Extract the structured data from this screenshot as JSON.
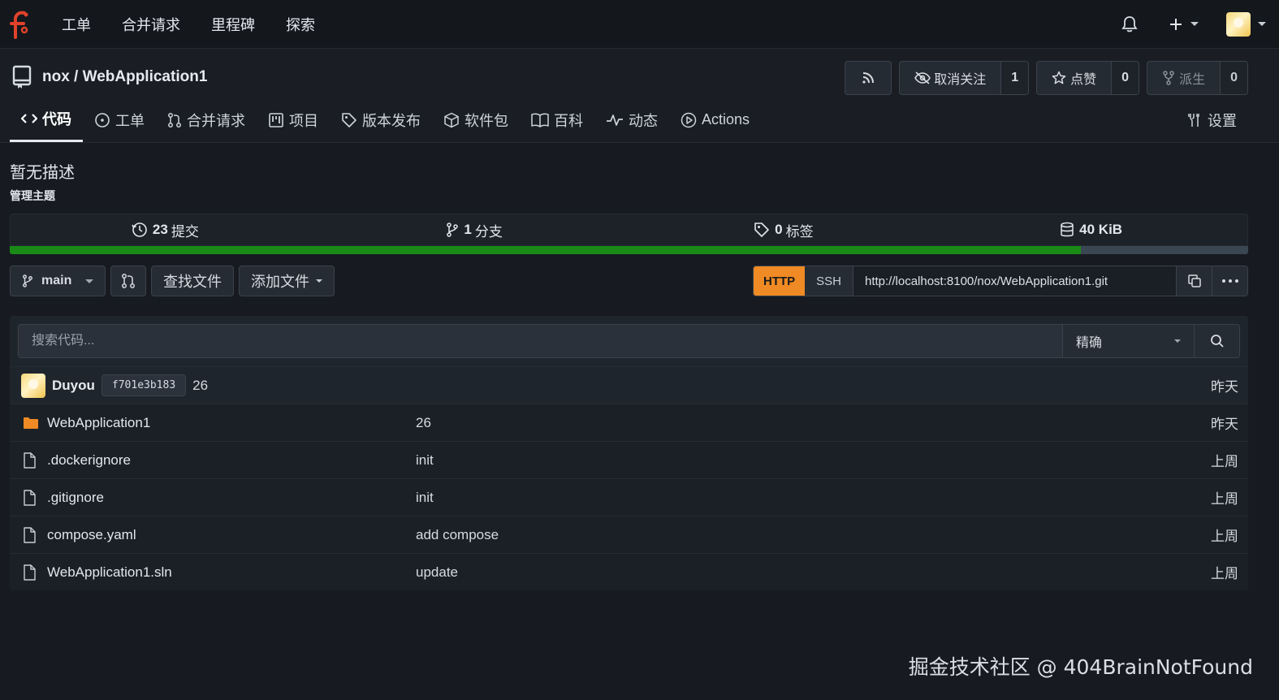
{
  "nav": {
    "items": [
      "工单",
      "合并请求",
      "里程碑",
      "探索"
    ]
  },
  "repo": {
    "title": "nox / WebApplication1",
    "unwatch_label": "取消关注",
    "watch_count": "1",
    "star_label": "点赞",
    "star_count": "0",
    "fork_label": "派生",
    "fork_count": "0"
  },
  "tabs": {
    "code": "代码",
    "issues": "工单",
    "pulls": "合并请求",
    "projects": "项目",
    "releases": "版本发布",
    "packages": "软件包",
    "wiki": "百科",
    "activity": "动态",
    "actions": "Actions",
    "settings": "设置"
  },
  "summary": {
    "description": "暂无描述",
    "topics": "管理主题",
    "commits_num": "23",
    "commits_label": "提交",
    "branches_num": "1",
    "branches_label": "分支",
    "tags_num": "0",
    "tags_label": "标签",
    "size": "40 KiB",
    "lang_fill_fraction": 0.865,
    "lang_color": "#1a8a16"
  },
  "toolbar": {
    "branch": "main",
    "find_file": "查找文件",
    "add_file": "添加文件",
    "http": "HTTP",
    "ssh": "SSH",
    "clone_url": "http://localhost:8100/nox/WebApplication1.git"
  },
  "search": {
    "placeholder": "搜索代码...",
    "mode": "精确"
  },
  "latest_commit": {
    "author": "Duyou",
    "sha": "f701e3b183",
    "message": "26",
    "when": "昨天"
  },
  "files": [
    {
      "name": "WebApplication1",
      "type": "folder",
      "message": "26",
      "when": "昨天"
    },
    {
      "name": ".dockerignore",
      "type": "file",
      "message": "init",
      "when": "上周"
    },
    {
      "name": ".gitignore",
      "type": "file",
      "message": "init",
      "when": "上周"
    },
    {
      "name": "compose.yaml",
      "type": "file",
      "message": "add compose",
      "when": "上周"
    },
    {
      "name": "WebApplication1.sln",
      "type": "file",
      "message": "update",
      "when": "上周"
    }
  ],
  "watermark": "掘金技术社区 @ 404BrainNotFound",
  "colors": {
    "accent": "#f08a24",
    "lang_bar": "#1a8a16",
    "folder": "#f08a24"
  }
}
